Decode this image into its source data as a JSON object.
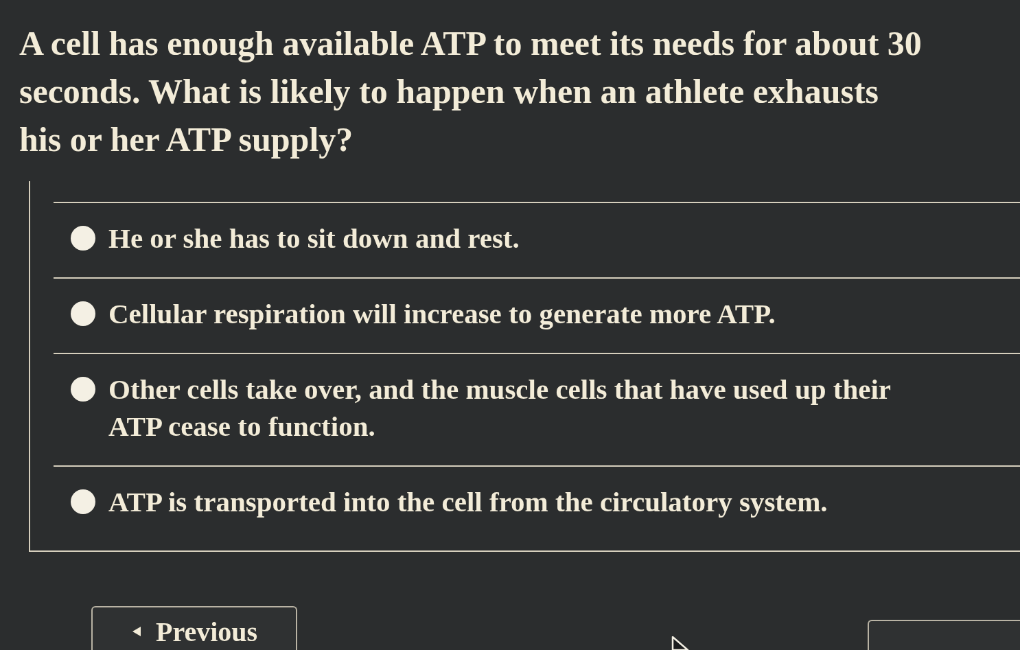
{
  "question": "A cell has enough available ATP to meet its needs for about 30 seconds. What is likely to happen when an athlete exhausts his or her ATP supply?",
  "options": [
    {
      "text": "He or she has to sit down and rest.",
      "selected": false
    },
    {
      "text": "Cellular respiration will increase to generate more ATP.",
      "selected": false
    },
    {
      "text": "Other cells take over, and the muscle cells that have used up their ATP cease to function.",
      "selected": false
    },
    {
      "text": "ATP is transported into the cell from the circulatory system.",
      "selected": false
    }
  ],
  "navigation": {
    "previous": {
      "label": "Previous"
    }
  }
}
